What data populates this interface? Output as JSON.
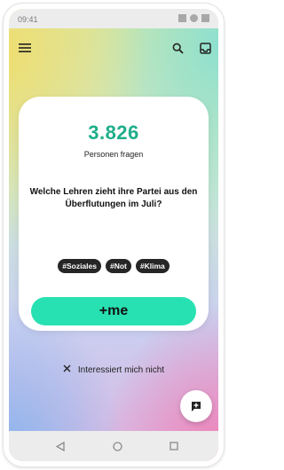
{
  "statusbar": {
    "time": "09:41"
  },
  "card": {
    "count": "3.826",
    "count_label": "Personen fragen",
    "question": "Welche Lehren zieht ihre Partei aus den Überflutungen im Juli?",
    "tags": [
      "#Soziales",
      "#Not",
      "#Klima"
    ],
    "action_label": "+me"
  },
  "not_interested": "Interessiert mich nicht",
  "colors": {
    "accent": "#28e1b2",
    "count_color": "#1fae8a",
    "tag_bg": "#262626"
  }
}
